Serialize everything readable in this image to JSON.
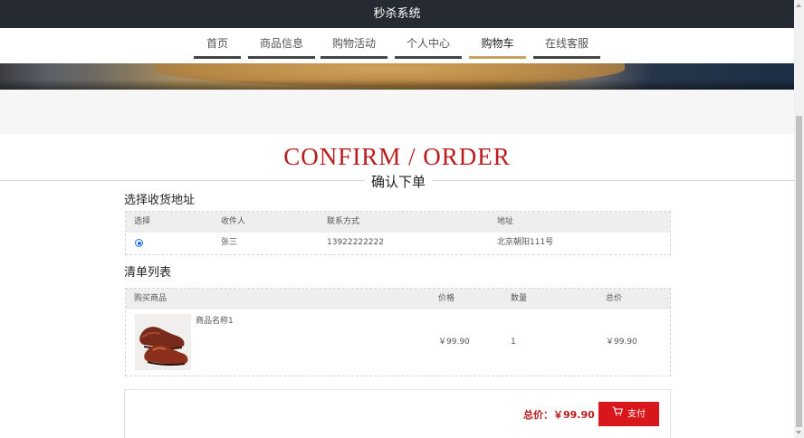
{
  "header": {
    "title": "秒杀系统"
  },
  "nav": {
    "items": [
      {
        "label": "首页"
      },
      {
        "label": "商品信息"
      },
      {
        "label": "购物活动"
      },
      {
        "label": "个人中心"
      },
      {
        "label": "购物车",
        "active": true
      },
      {
        "label": "在线客服"
      }
    ],
    "active_color": "#c7a25c"
  },
  "hero": {
    "title": "CONFIRM / ORDER",
    "subtitle": "确认下单",
    "title_color": "#b81c1c"
  },
  "address": {
    "section_title": "选择收货地址",
    "columns": [
      "选择",
      "收件人",
      "联系方式",
      "地址"
    ],
    "rows": [
      {
        "selected": true,
        "recipient": "张三",
        "phone": "13922222222",
        "address": "北京朝阳111号"
      }
    ]
  },
  "items": {
    "section_title": "清单列表",
    "columns": [
      "购买商品",
      "价格",
      "数量",
      "总价"
    ],
    "rows": [
      {
        "image_icon": "shoe-image",
        "name": "商品名称1",
        "price": "￥99.90",
        "quantity": "1",
        "total": "￥99.90"
      }
    ]
  },
  "checkout": {
    "total_label": "总价：",
    "total_value": "￥99.90",
    "pay_label": "支付",
    "pay_icon": "cart-icon",
    "button_color": "#d8171c"
  }
}
